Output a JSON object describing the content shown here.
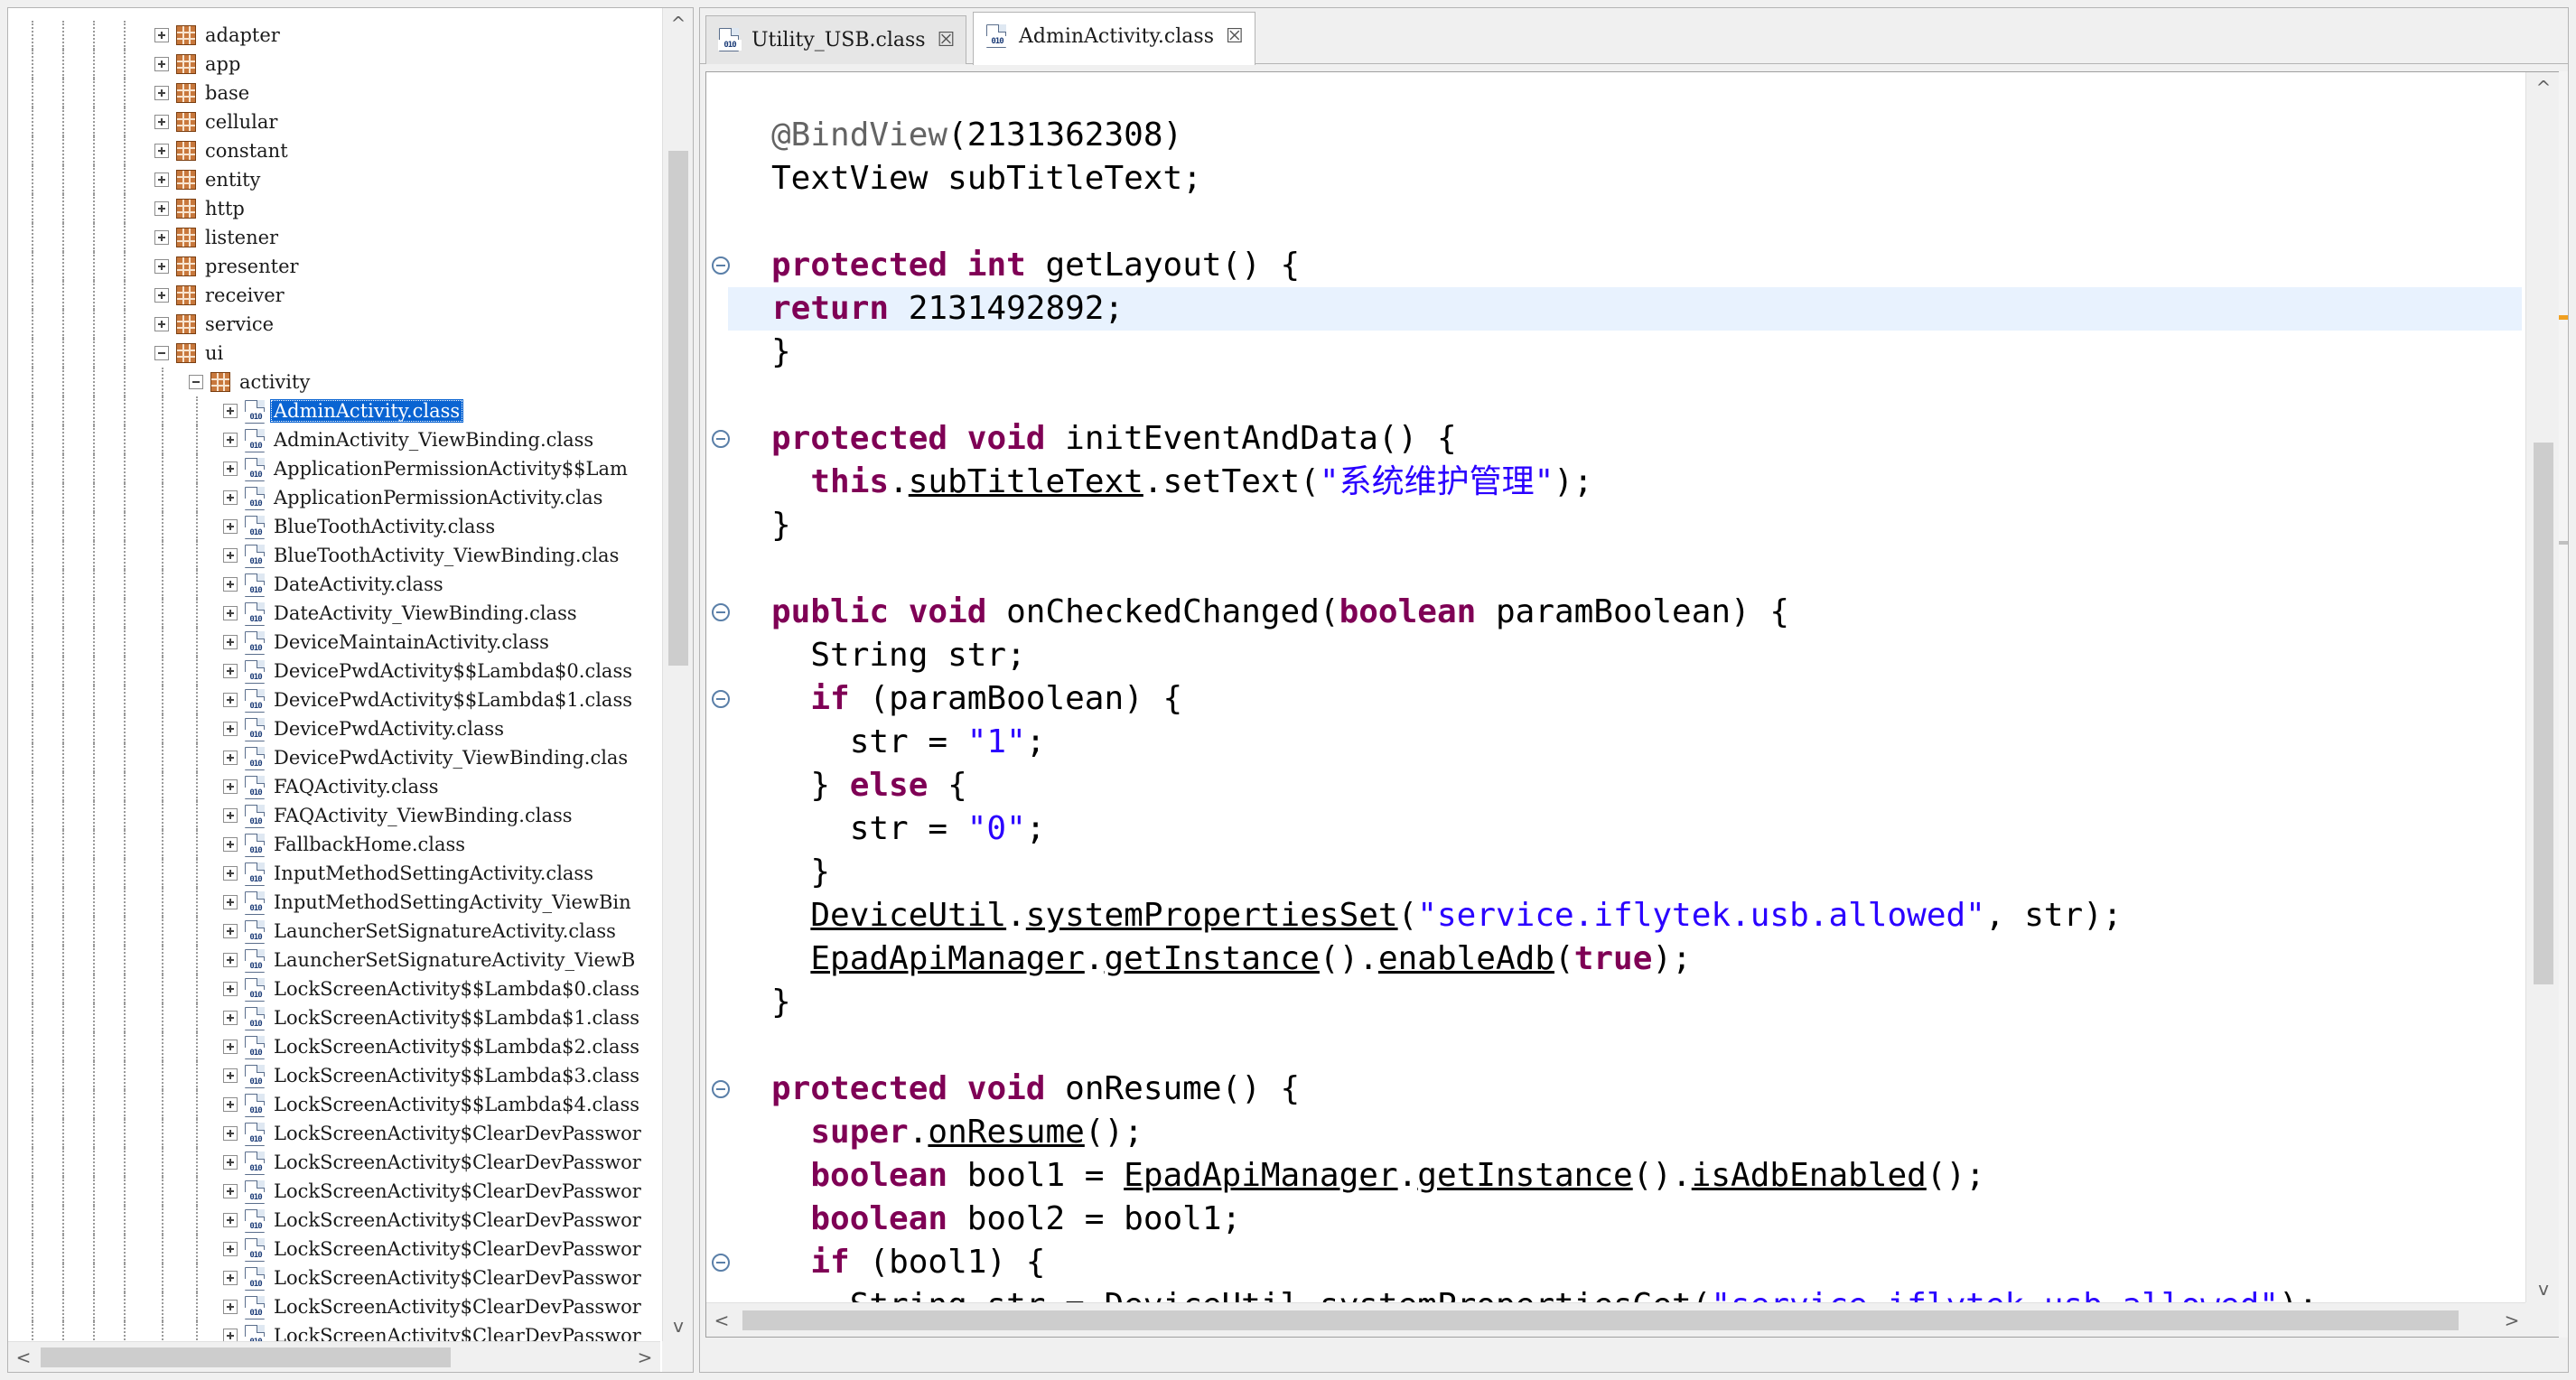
{
  "tree": {
    "rows": [
      {
        "label": "adapter",
        "kind": "package",
        "level": 0,
        "expanded": false
      },
      {
        "label": "app",
        "kind": "package",
        "level": 0,
        "expanded": false
      },
      {
        "label": "base",
        "kind": "package",
        "level": 0,
        "expanded": false
      },
      {
        "label": "cellular",
        "kind": "package",
        "level": 0,
        "expanded": false
      },
      {
        "label": "constant",
        "kind": "package",
        "level": 0,
        "expanded": false
      },
      {
        "label": "entity",
        "kind": "package",
        "level": 0,
        "expanded": false
      },
      {
        "label": "http",
        "kind": "package",
        "level": 0,
        "expanded": false
      },
      {
        "label": "listener",
        "kind": "package",
        "level": 0,
        "expanded": false
      },
      {
        "label": "presenter",
        "kind": "package",
        "level": 0,
        "expanded": false
      },
      {
        "label": "receiver",
        "kind": "package",
        "level": 0,
        "expanded": false
      },
      {
        "label": "service",
        "kind": "package",
        "level": 0,
        "expanded": false
      },
      {
        "label": "ui",
        "kind": "package",
        "level": 0,
        "expanded": true
      },
      {
        "label": "activity",
        "kind": "package",
        "level": 1,
        "expanded": true
      },
      {
        "label": "AdminActivity.class",
        "kind": "class",
        "level": 2,
        "selected": true
      },
      {
        "label": "AdminActivity_ViewBinding.class",
        "kind": "class",
        "level": 2
      },
      {
        "label": "ApplicationPermissionActivity$$Lam",
        "kind": "class",
        "level": 2
      },
      {
        "label": "ApplicationPermissionActivity.clas",
        "kind": "class",
        "level": 2
      },
      {
        "label": "BlueToothActivity.class",
        "kind": "class",
        "level": 2
      },
      {
        "label": "BlueToothActivity_ViewBinding.clas",
        "kind": "class",
        "level": 2
      },
      {
        "label": "DateActivity.class",
        "kind": "class",
        "level": 2
      },
      {
        "label": "DateActivity_ViewBinding.class",
        "kind": "class",
        "level": 2
      },
      {
        "label": "DeviceMaintainActivity.class",
        "kind": "class",
        "level": 2
      },
      {
        "label": "DevicePwdActivity$$Lambda$0.class",
        "kind": "class",
        "level": 2
      },
      {
        "label": "DevicePwdActivity$$Lambda$1.class",
        "kind": "class",
        "level": 2
      },
      {
        "label": "DevicePwdActivity.class",
        "kind": "class",
        "level": 2
      },
      {
        "label": "DevicePwdActivity_ViewBinding.clas",
        "kind": "class",
        "level": 2
      },
      {
        "label": "FAQActivity.class",
        "kind": "class",
        "level": 2
      },
      {
        "label": "FAQActivity_ViewBinding.class",
        "kind": "class",
        "level": 2
      },
      {
        "label": "FallbackHome.class",
        "kind": "class",
        "level": 2
      },
      {
        "label": "InputMethodSettingActivity.class",
        "kind": "class",
        "level": 2
      },
      {
        "label": "InputMethodSettingActivity_ViewBin",
        "kind": "class",
        "level": 2
      },
      {
        "label": "LauncherSetSignatureActivity.class",
        "kind": "class",
        "level": 2
      },
      {
        "label": "LauncherSetSignatureActivity_ViewB",
        "kind": "class",
        "level": 2
      },
      {
        "label": "LockScreenActivity$$Lambda$0.class",
        "kind": "class",
        "level": 2
      },
      {
        "label": "LockScreenActivity$$Lambda$1.class",
        "kind": "class",
        "level": 2
      },
      {
        "label": "LockScreenActivity$$Lambda$2.class",
        "kind": "class",
        "level": 2
      },
      {
        "label": "LockScreenActivity$$Lambda$3.class",
        "kind": "class",
        "level": 2
      },
      {
        "label": "LockScreenActivity$$Lambda$4.class",
        "kind": "class",
        "level": 2
      },
      {
        "label": "LockScreenActivity$ClearDevPasswor",
        "kind": "class",
        "level": 2
      },
      {
        "label": "LockScreenActivity$ClearDevPasswor",
        "kind": "class",
        "level": 2
      },
      {
        "label": "LockScreenActivity$ClearDevPasswor",
        "kind": "class",
        "level": 2
      },
      {
        "label": "LockScreenActivity$ClearDevPasswor",
        "kind": "class",
        "level": 2
      },
      {
        "label": "LockScreenActivity$ClearDevPasswor",
        "kind": "class",
        "level": 2
      },
      {
        "label": "LockScreenActivity$ClearDevPasswor",
        "kind": "class",
        "level": 2
      },
      {
        "label": "LockScreenActivity$ClearDevPasswor",
        "kind": "class",
        "level": 2
      },
      {
        "label": "LockScreenActivity$ClearDevPasswor",
        "kind": "class",
        "level": 2
      }
    ]
  },
  "tabs": [
    {
      "label": "Utility_USB.class",
      "close": "☒",
      "active": false,
      "icon": "class-file-icon"
    },
    {
      "label": "AdminActivity.class",
      "close": "☒",
      "active": true,
      "icon": "class-file-icon"
    }
  ],
  "icons": {
    "package": "package-icon",
    "class": "class-file-icon",
    "class_badge": "010",
    "scroll_up": "^",
    "scroll_down": "v",
    "scroll_left": "<",
    "scroll_right": ">"
  },
  "code": {
    "lines": [
      {
        "tokens": [
          {
            "t": "@BindView",
            "c": "ann"
          },
          {
            "t": "(2131362308)"
          }
        ]
      },
      {
        "tokens": [
          {
            "t": "TextView subTitleText;"
          }
        ]
      },
      {
        "tokens": []
      },
      {
        "fold": true,
        "tokens": [
          {
            "t": "protected",
            "c": "kw"
          },
          {
            "t": " "
          },
          {
            "t": "int",
            "c": "kw"
          },
          {
            "t": " getLayout() {"
          }
        ]
      },
      {
        "highlight": true,
        "tokens": [
          {
            "t": "return",
            "c": "kw"
          },
          {
            "t": " 2131492892;"
          }
        ]
      },
      {
        "tokens": [
          {
            "t": "}"
          }
        ]
      },
      {
        "tokens": []
      },
      {
        "fold": true,
        "tokens": [
          {
            "t": "protected",
            "c": "kw"
          },
          {
            "t": " "
          },
          {
            "t": "void",
            "c": "kw"
          },
          {
            "t": " initEventAndData() {"
          }
        ]
      },
      {
        "tokens": [
          {
            "t": "  "
          },
          {
            "t": "this",
            "c": "kw"
          },
          {
            "t": "."
          },
          {
            "t": "subTitleText",
            "c": "ul"
          },
          {
            "t": ".setText("
          },
          {
            "t": "\"系统维护管理\"",
            "c": "str"
          },
          {
            "t": ");"
          }
        ]
      },
      {
        "tokens": [
          {
            "t": "}"
          }
        ]
      },
      {
        "tokens": []
      },
      {
        "fold": true,
        "tokens": [
          {
            "t": "public",
            "c": "kw"
          },
          {
            "t": " "
          },
          {
            "t": "void",
            "c": "kw"
          },
          {
            "t": " onCheckedChanged("
          },
          {
            "t": "boolean",
            "c": "kw"
          },
          {
            "t": " paramBoolean) {"
          }
        ]
      },
      {
        "tokens": [
          {
            "t": "  String str;"
          }
        ]
      },
      {
        "fold": true,
        "tokens": [
          {
            "t": "  "
          },
          {
            "t": "if",
            "c": "kw"
          },
          {
            "t": " (paramBoolean) {"
          }
        ]
      },
      {
        "tokens": [
          {
            "t": "    str = "
          },
          {
            "t": "\"1\"",
            "c": "str"
          },
          {
            "t": ";"
          }
        ]
      },
      {
        "tokens": [
          {
            "t": "  } "
          },
          {
            "t": "else",
            "c": "kw"
          },
          {
            "t": " {"
          }
        ]
      },
      {
        "tokens": [
          {
            "t": "    str = "
          },
          {
            "t": "\"0\"",
            "c": "str"
          },
          {
            "t": ";"
          }
        ]
      },
      {
        "tokens": [
          {
            "t": "  }"
          }
        ]
      },
      {
        "tokens": [
          {
            "t": "  "
          },
          {
            "t": "DeviceUtil",
            "c": "ul"
          },
          {
            "t": "."
          },
          {
            "t": "systemPropertiesSet",
            "c": "ul"
          },
          {
            "t": "("
          },
          {
            "t": "\"service.iflytek.usb.allowed\"",
            "c": "str"
          },
          {
            "t": ", str);"
          }
        ]
      },
      {
        "tokens": [
          {
            "t": "  "
          },
          {
            "t": "EpadApiManager",
            "c": "ul"
          },
          {
            "t": "."
          },
          {
            "t": "getInstance",
            "c": "ul"
          },
          {
            "t": "()."
          },
          {
            "t": "enableAdb",
            "c": "ul"
          },
          {
            "t": "("
          },
          {
            "t": "true",
            "c": "kw"
          },
          {
            "t": ");"
          }
        ]
      },
      {
        "tokens": [
          {
            "t": "}"
          }
        ]
      },
      {
        "tokens": []
      },
      {
        "fold": true,
        "tokens": [
          {
            "t": "protected",
            "c": "kw"
          },
          {
            "t": " "
          },
          {
            "t": "void",
            "c": "kw"
          },
          {
            "t": " onResume() {"
          }
        ]
      },
      {
        "tokens": [
          {
            "t": "  "
          },
          {
            "t": "super",
            "c": "kw"
          },
          {
            "t": "."
          },
          {
            "t": "onResume",
            "c": "ul"
          },
          {
            "t": "();"
          }
        ]
      },
      {
        "tokens": [
          {
            "t": "  "
          },
          {
            "t": "boolean",
            "c": "kw"
          },
          {
            "t": " bool1 = "
          },
          {
            "t": "EpadApiManager",
            "c": "ul"
          },
          {
            "t": "."
          },
          {
            "t": "getInstance",
            "c": "ul"
          },
          {
            "t": "()."
          },
          {
            "t": "isAdbEnabled",
            "c": "ul"
          },
          {
            "t": "();"
          }
        ]
      },
      {
        "tokens": [
          {
            "t": "  "
          },
          {
            "t": "boolean",
            "c": "kw"
          },
          {
            "t": " bool2 = bool1;"
          }
        ]
      },
      {
        "fold": true,
        "tokens": [
          {
            "t": "  "
          },
          {
            "t": "if",
            "c": "kw"
          },
          {
            "t": " (bool1) {"
          }
        ]
      },
      {
        "tokens": [
          {
            "t": "    String str = "
          },
          {
            "t": "DeviceUtil",
            "c": "ul"
          },
          {
            "t": "."
          },
          {
            "t": "systemPropertiesGet",
            "c": "ul"
          },
          {
            "t": "("
          },
          {
            "t": "\"service.iflytek.usb.allowed\"",
            "c": "str"
          },
          {
            "t": ");"
          }
        ]
      }
    ]
  },
  "colors": {
    "keyword": "#7f0055",
    "string": "#2a00ff",
    "annotation": "#646464",
    "selection": "#0a64d2",
    "current_line": "#e8f2fe"
  }
}
